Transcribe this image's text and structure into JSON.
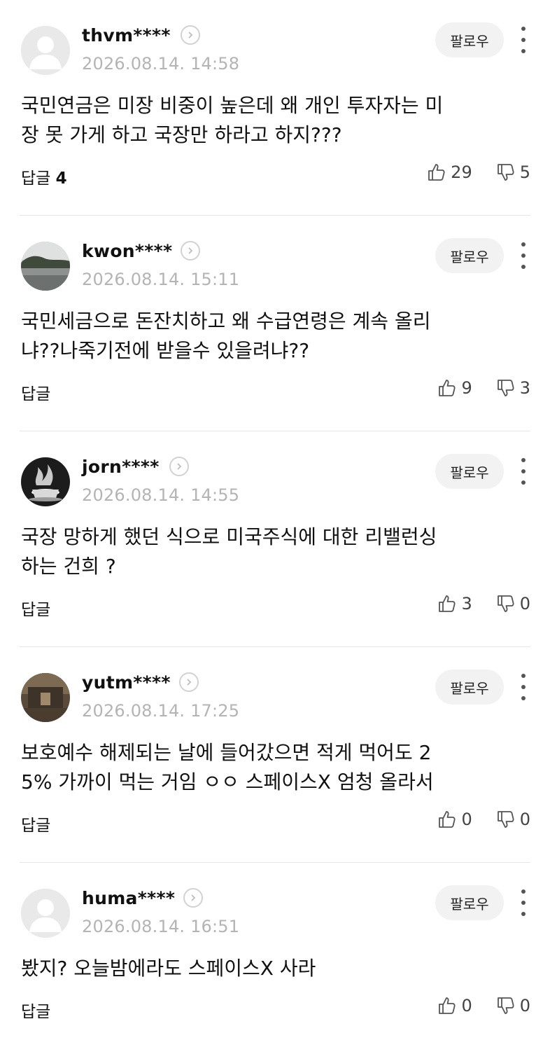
{
  "labels": {
    "follow": "팔로우",
    "reply": "답글"
  },
  "comments": [
    {
      "username": "thvm****",
      "date": "2026.08.14. 14:58",
      "body": "국민연금은 미장 비중이 높은데 왜 개인 투자자는 미\n장 못 가게 하고 국장만 하라고 하지???",
      "reply_count": "4",
      "likes": "29",
      "dislikes": "5",
      "avatar": "default-avatar"
    },
    {
      "username": "kwon****",
      "date": "2026.08.14. 15:11",
      "body": "국민세금으로 돈잔치하고 왜 수급연령은 계속 올리\n냐??나죽기전에 받을수 있을려냐??",
      "reply_count": "",
      "likes": "9",
      "dislikes": "3",
      "avatar": "lake-photo-avatar"
    },
    {
      "username": "jorn****",
      "date": "2026.08.14. 14:55",
      "body": "국장 망하게 했던 식으로 미국주식에 대한 리밸런싱\n하는 건희 ?",
      "reply_count": "",
      "likes": "3",
      "dislikes": "0",
      "avatar": "coffee-photo-avatar"
    },
    {
      "username": "yutm****",
      "date": "2026.08.14. 17:25",
      "body": "보호예수 해제되는 날에 들어갔으면 적게 먹어도 2\n5% 가까이 먹는 거임 ㅇㅇ 스페이스X 엄청 올라서",
      "reply_count": "",
      "likes": "0",
      "dislikes": "0",
      "avatar": "painting-photo-avatar"
    },
    {
      "username": "huma****",
      "date": "2026.08.14. 16:51",
      "body": "봤지? 오늘밤에라도 스페이스X 사라",
      "reply_count": "",
      "likes": "0",
      "dislikes": "0",
      "avatar": "default-avatar"
    }
  ]
}
